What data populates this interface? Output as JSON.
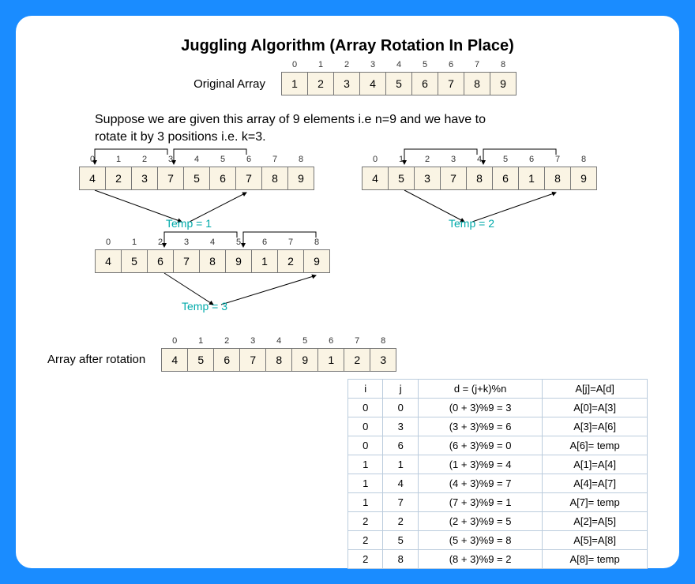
{
  "title": "Juggling Algorithm  (Array Rotation In Place)",
  "original_label": "Original Array",
  "final_label": "Array after rotation",
  "description": "Suppose we are given this array of 9 elements i.e n=9 and we have to rotate it by 3 positions i.e. k=3.",
  "indices": [
    "0",
    "1",
    "2",
    "3",
    "4",
    "5",
    "6",
    "7",
    "8"
  ],
  "arrays": {
    "original": [
      "1",
      "2",
      "3",
      "4",
      "5",
      "6",
      "7",
      "8",
      "9"
    ],
    "step1": [
      "4",
      "2",
      "3",
      "7",
      "5",
      "6",
      "7",
      "8",
      "9"
    ],
    "step2": [
      "4",
      "5",
      "3",
      "7",
      "8",
      "6",
      "1",
      "8",
      "9"
    ],
    "step3": [
      "4",
      "5",
      "6",
      "7",
      "8",
      "9",
      "1",
      "2",
      "9"
    ],
    "final": [
      "4",
      "5",
      "6",
      "7",
      "8",
      "9",
      "1",
      "2",
      "3"
    ]
  },
  "temps": {
    "t1": "Temp = 1",
    "t2": "Temp = 2",
    "t3": "Temp =  3"
  },
  "table": {
    "headers": [
      "i",
      "j",
      "d = (j+k)%n",
      "A[j]=A[d]"
    ],
    "rows": [
      [
        "0",
        "0",
        "(0 + 3)%9 = 3",
        "A[0]=A[3]"
      ],
      [
        "0",
        "3",
        "(3 + 3)%9 = 6",
        "A[3]=A[6]"
      ],
      [
        "0",
        "6",
        "(6 + 3)%9 = 0",
        "A[6]= temp"
      ],
      [
        "1",
        "1",
        "(1 + 3)%9 = 4",
        "A[1]=A[4]"
      ],
      [
        "1",
        "4",
        "(4 + 3)%9 = 7",
        "A[4]=A[7]"
      ],
      [
        "1",
        "7",
        "(7 + 3)%9 = 1",
        "A[7]= temp"
      ],
      [
        "2",
        "2",
        "(2 + 3)%9 = 5",
        "A[2]=A[5]"
      ],
      [
        "2",
        "5",
        "(5 + 3)%9 = 8",
        "A[5]=A[8]"
      ],
      [
        "2",
        "8",
        "(8 + 3)%9 = 2",
        "A[8]= temp"
      ]
    ]
  }
}
